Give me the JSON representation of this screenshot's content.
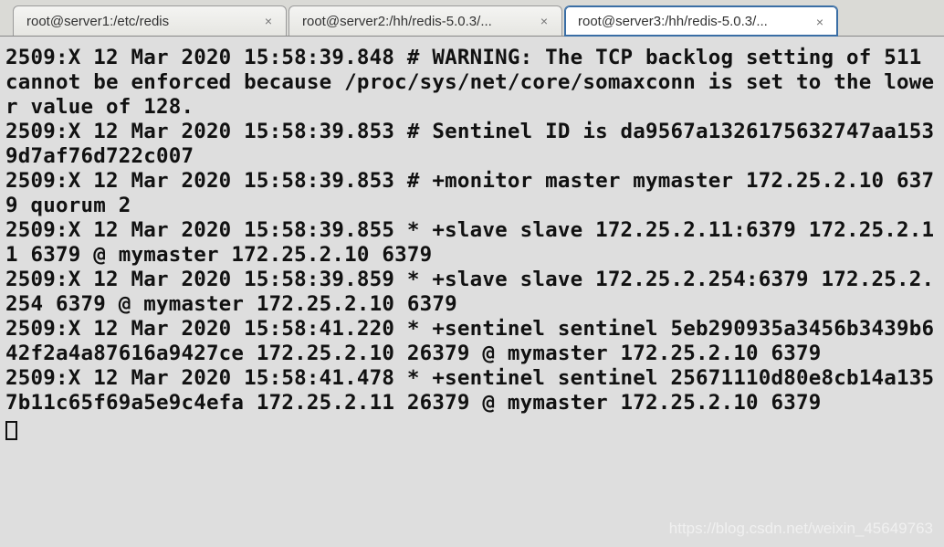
{
  "tabs": [
    {
      "label": "root@server1:/etc/redis",
      "active": false
    },
    {
      "label": "root@server2:/hh/redis-5.0.3/...",
      "active": false
    },
    {
      "label": "root@server3:/hh/redis-5.0.3/...",
      "active": true
    }
  ],
  "terminal_output": "2509:X 12 Mar 2020 15:58:39.848 # WARNING: The TCP backlog setting of 511 cannot be enforced because /proc/sys/net/core/somaxconn is set to the lower value of 128.\n2509:X 12 Mar 2020 15:58:39.853 # Sentinel ID is da9567a1326175632747aa1539d7af76d722c007\n2509:X 12 Mar 2020 15:58:39.853 # +monitor master mymaster 172.25.2.10 6379 quorum 2\n2509:X 12 Mar 2020 15:58:39.855 * +slave slave 172.25.2.11:6379 172.25.2.11 6379 @ mymaster 172.25.2.10 6379\n2509:X 12 Mar 2020 15:58:39.859 * +slave slave 172.25.2.254:6379 172.25.2.254 6379 @ mymaster 172.25.2.10 6379\n2509:X 12 Mar 2020 15:58:41.220 * +sentinel sentinel 5eb290935a3456b3439b642f2a4a87616a9427ce 172.25.2.10 26379 @ mymaster 172.25.2.10 6379\n2509:X 12 Mar 2020 15:58:41.478 * +sentinel sentinel 25671110d80e8cb14a1357b11c65f69a5e9c4efa 172.25.2.11 26379 @ mymaster 172.25.2.10 6379\n",
  "watermark": "https://blog.csdn.net/weixin_45649763",
  "close_glyph": "×"
}
